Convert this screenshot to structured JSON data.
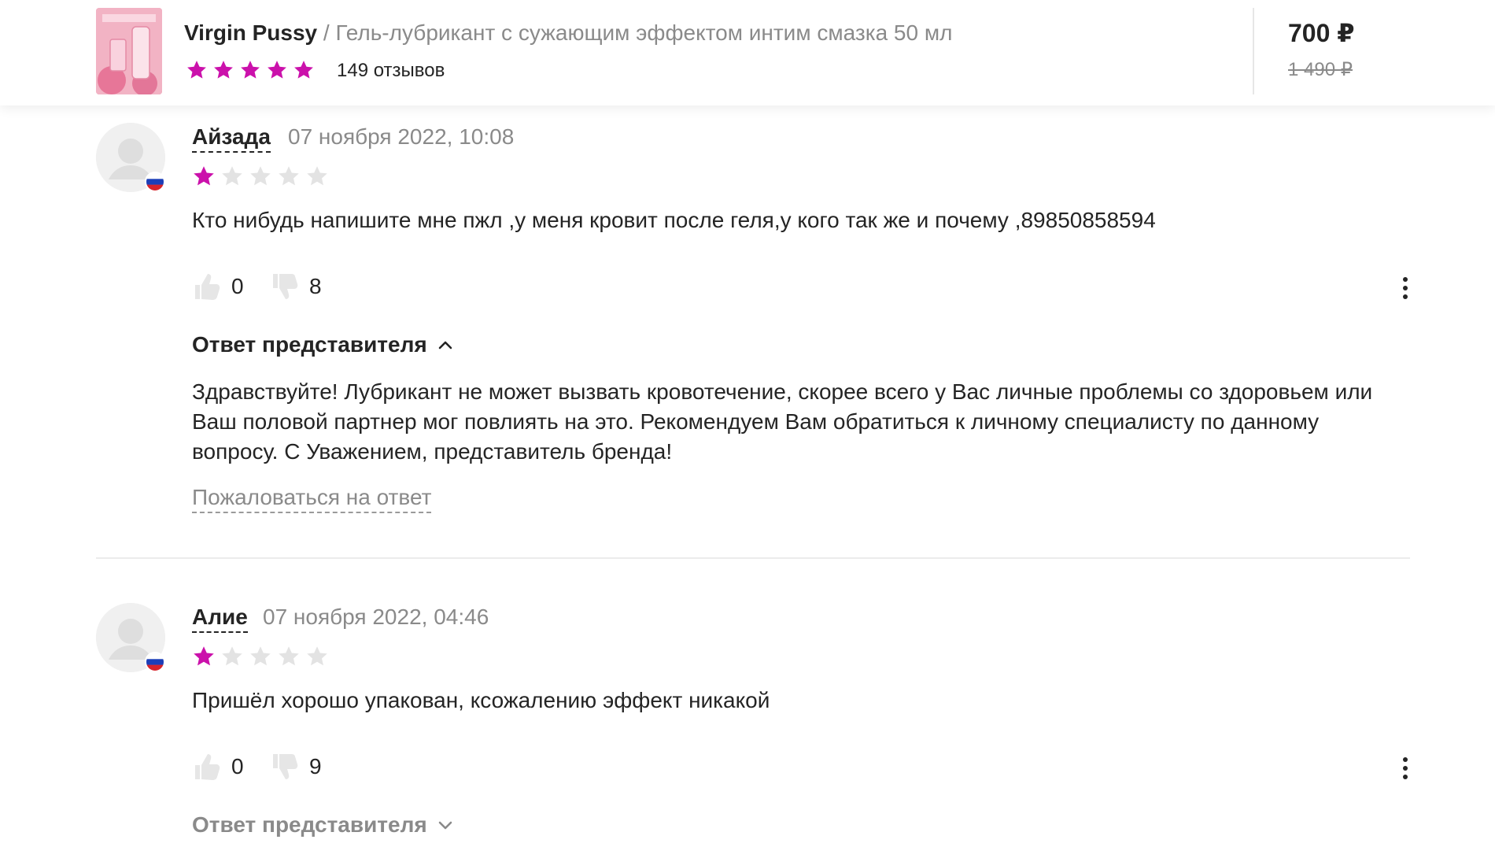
{
  "header": {
    "brand": "Virgin Pussy",
    "separator": " / ",
    "product_name": "Гель-лубрикант с сужающим эффектом интим смазка 50 мл",
    "rating_stars": 5,
    "reviews_count": "149 отзывов",
    "price_current": "700 ₽",
    "price_old": "1 490 ₽",
    "thumbnail_label": "Virgin pussy"
  },
  "colors": {
    "star_active": "#cb11ab",
    "star_inactive": "#e3e3e3",
    "text_primary": "#242424",
    "text_secondary": "#8a8a8a"
  },
  "reviews": [
    {
      "author": "Айзада",
      "date": "07 ноября 2022, 10:08",
      "rating": 1,
      "text": "Кто нибудь напишите мне пжл ,у меня кровит после геля,у кого так же и почему ,89850858594",
      "likes": "0",
      "dislikes": "8",
      "rep_toggle": "Ответ представителя",
      "rep_expanded": true,
      "rep_text": "Здравствуйте! Лубрикант не может вызвать кровотечение, скорее всего у Вас личные проблемы со здоровьем или\nВаш половой партнер мог повлиять на это. Рекомендуем Вам обратиться к личному специалисту по данному\nвопросу. С Уважением, представитель бренда!",
      "complain": "Пожаловаться на ответ"
    },
    {
      "author": "Алие",
      "date": "07 ноября 2022, 04:46",
      "rating": 1,
      "text": "Пришёл хорошо упакован, ксожалению эффект никакой",
      "likes": "0",
      "dislikes": "9",
      "rep_toggle": "Ответ представителя",
      "rep_expanded": false
    }
  ]
}
